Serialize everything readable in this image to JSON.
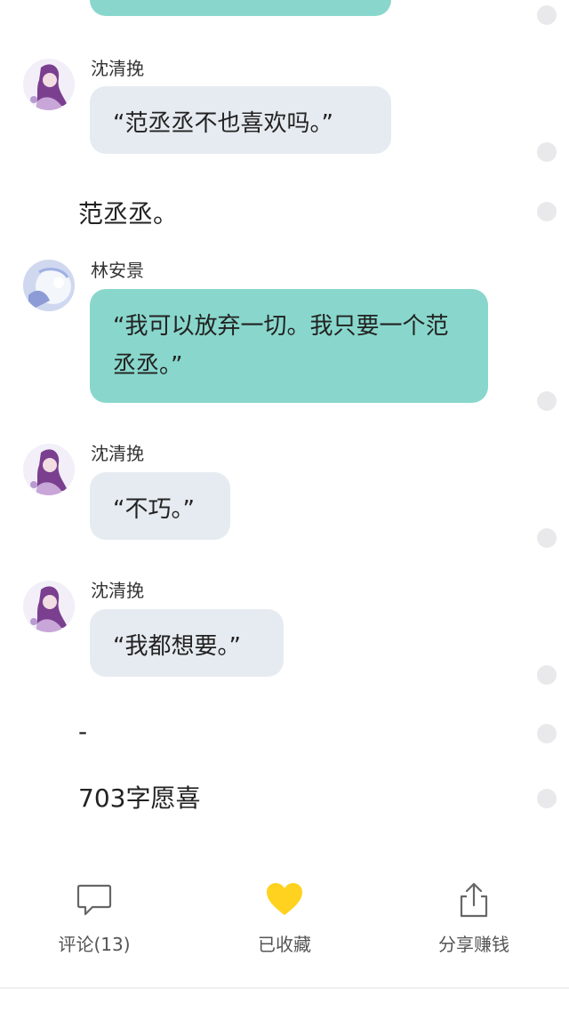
{
  "chat": [
    {
      "speaker": "沈清挽",
      "text": "“范丞丞不也喜欢吗。”"
    },
    {
      "speaker": "林安景",
      "text": "“我可以放弃一切。我只要一个范丞丞。”"
    },
    {
      "speaker": "沈清挽",
      "text": "“不巧。”"
    },
    {
      "speaker": "沈清挽",
      "text": "“我都想要。”"
    }
  ],
  "narration": [
    "范丞丞。",
    "-",
    "703字愿喜"
  ],
  "actions": {
    "comment": {
      "label": "评论(13)",
      "icon": "comment-icon"
    },
    "favorite": {
      "label": "已收藏",
      "icon": "heart-icon"
    },
    "share": {
      "label": "分享赚钱",
      "icon": "share-icon"
    }
  },
  "colors": {
    "teal_bubble": "#89d7cc",
    "gray_bubble": "#e6ebf1",
    "heart": "#ffd21f"
  }
}
